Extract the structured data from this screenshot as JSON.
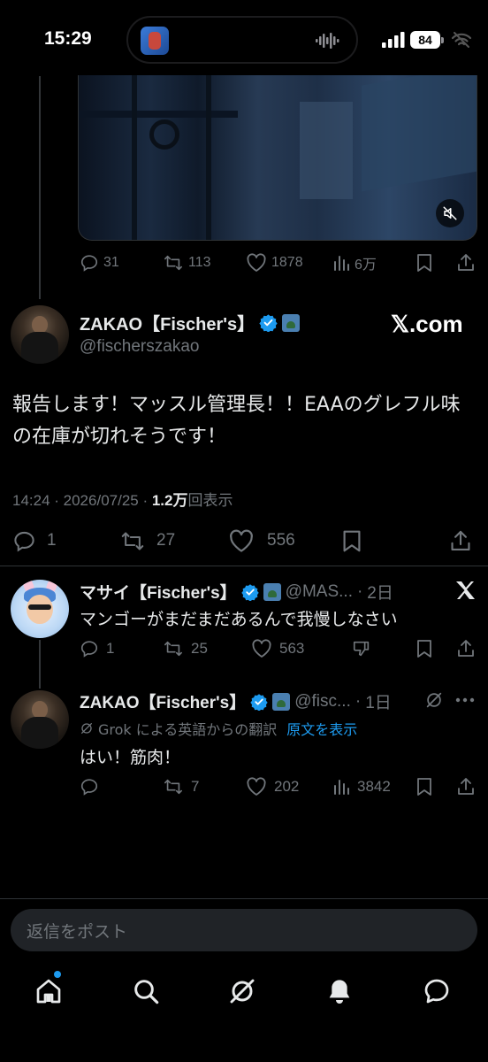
{
  "status_bar": {
    "time": "15:29",
    "battery": "84"
  },
  "top_tweet": {
    "stats": {
      "replies": "31",
      "reposts": "113",
      "likes": "1878",
      "views": "6万"
    }
  },
  "focused_tweet": {
    "name": "ZAKAO【Fischer's】",
    "handle": "@fischerszakao",
    "source_logo": "𝕏.com",
    "text": "報告します！マッスル管理長！！EAAのグレフル味の在庫が切れそうです！",
    "meta_prefix": "14:24 · 2026/07/25 · ",
    "views_count": "1.2万",
    "views_label": "回表示",
    "stats": {
      "replies": "1",
      "reposts": "27",
      "likes": "556"
    }
  },
  "replies": [
    {
      "name": "マサイ【Fischer's】",
      "handle": "@MAS...",
      "age": "2日",
      "text": "マンゴーがまだまだあるんで我慢しなさい",
      "stats": {
        "replies": "1",
        "reposts": "25",
        "likes": "563"
      }
    },
    {
      "name": "ZAKAO【Fischer's】",
      "handle": "@fisc...",
      "age": "1日",
      "translation_note": "Grok による英語からの翻訳",
      "translation_link": "原文を表示",
      "text": "はい！筋肉！",
      "stats": {
        "replies": "",
        "reposts": "7",
        "likes": "202",
        "views": "3842"
      }
    }
  ],
  "compose": {
    "placeholder": "返信をポスト"
  },
  "colors": {
    "background": "#000000",
    "text": "#e7e9ea",
    "muted": "#71767b",
    "accent": "#1d9bf0",
    "divider": "#2f3336"
  },
  "icons": [
    "reply-icon",
    "repost-icon",
    "like-icon",
    "views-icon",
    "bookmark-icon",
    "share-icon",
    "mute-icon",
    "verified-icon",
    "grok-icon",
    "more-icon",
    "dislike-icon",
    "home-icon",
    "search-icon",
    "notifications-icon",
    "messages-icon"
  ]
}
